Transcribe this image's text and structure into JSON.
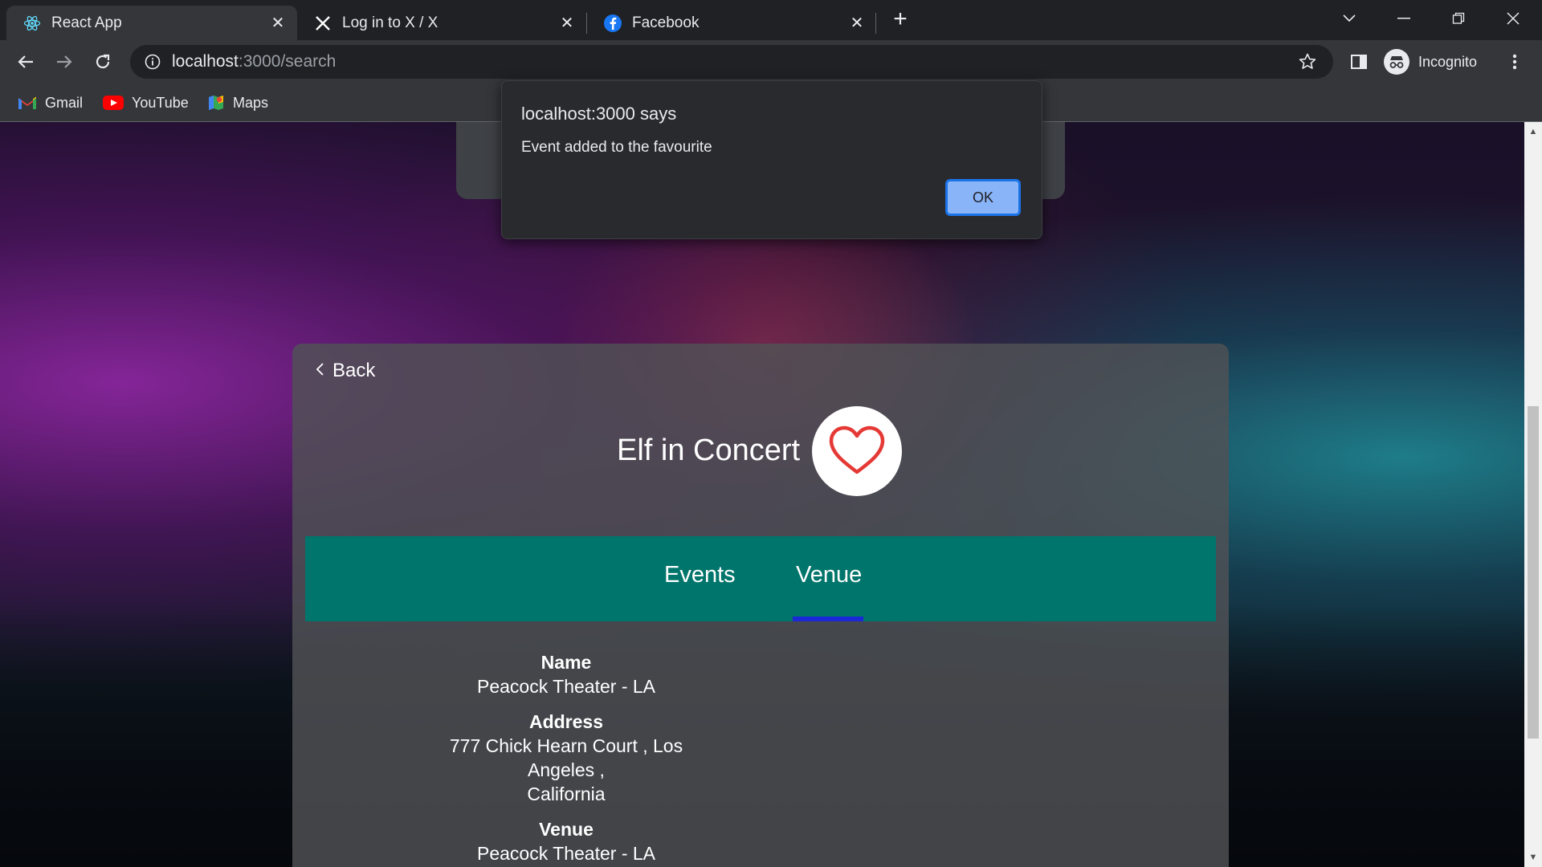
{
  "browser": {
    "tabs": [
      {
        "title": "React App",
        "icon": "react-icon",
        "active": true
      },
      {
        "title": "Log in to X / X",
        "icon": "x-logo-icon",
        "active": false
      },
      {
        "title": "Facebook",
        "icon": "facebook-icon",
        "active": false
      }
    ],
    "url": {
      "host": "localhost",
      "path": ":3000/search"
    },
    "bookmarks": [
      {
        "label": "Gmail",
        "icon": "gmail-icon"
      },
      {
        "label": "YouTube",
        "icon": "youtube-icon"
      },
      {
        "label": "Maps",
        "icon": "maps-icon"
      }
    ],
    "profile_label": "Incognito"
  },
  "dialog": {
    "title": "localhost:3000 says",
    "message": "Event added to the favourite",
    "ok_label": "OK"
  },
  "detail": {
    "back_label": "Back",
    "title": "Elf in Concert",
    "favourite": true,
    "tabs": [
      {
        "label": "Events",
        "active": false
      },
      {
        "label": "Venue",
        "active": true
      }
    ],
    "venue": {
      "name_label": "Name",
      "name": "Peacock Theater - LA",
      "address_label": "Address",
      "address_line1": "777 Chick Hearn Court , Los Angeles ,",
      "address_line2": "California",
      "venue_label": "Venue",
      "venue": "Peacock Theater - LA"
    }
  },
  "colors": {
    "tabs_bar": "#00756b",
    "active_tab_underline": "#1b28d6",
    "heart": "#e53935",
    "dialog_ok": "#8ab4f8"
  }
}
